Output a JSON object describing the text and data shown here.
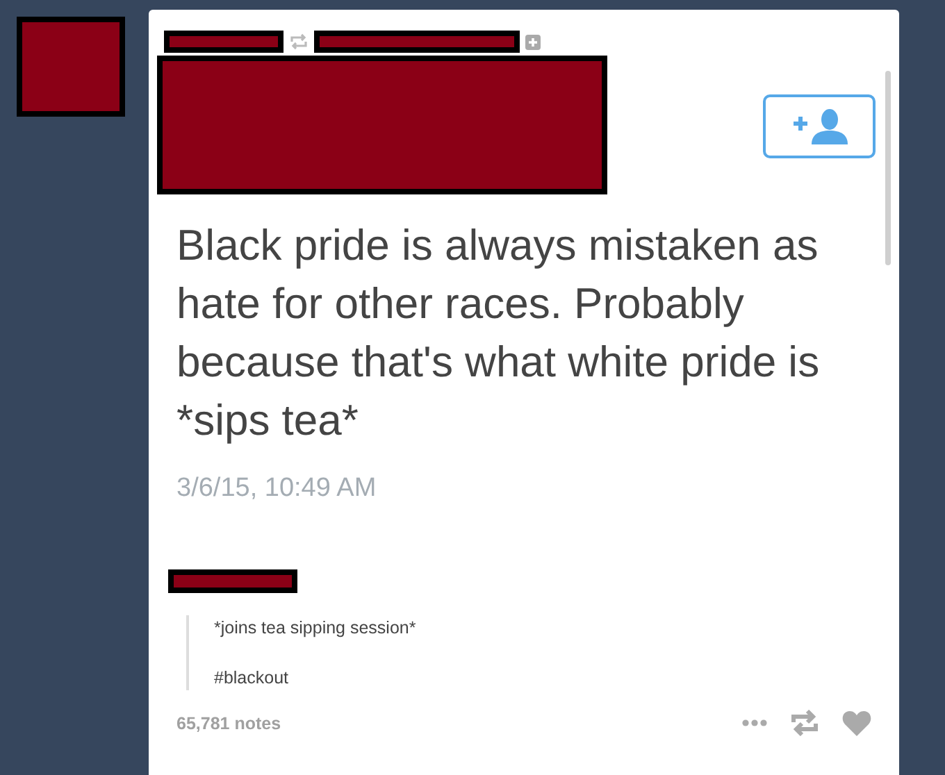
{
  "post": {
    "text": "Black pride is always mistaken as hate for other races. Probably because that's what white pride is *sips tea*",
    "date": "3/6/15, 10:49 AM"
  },
  "reblog": {
    "lines": [
      "*joins tea sipping session*",
      "#blackout"
    ]
  },
  "footer": {
    "notes": "65,781 notes"
  }
}
